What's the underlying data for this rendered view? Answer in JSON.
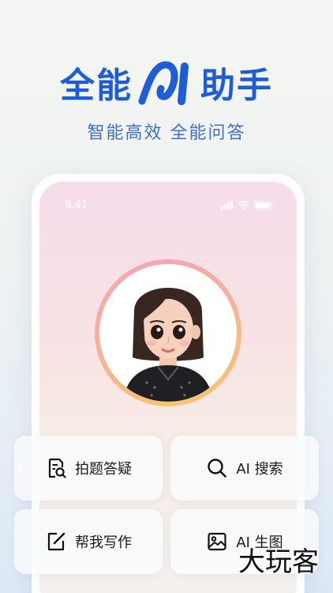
{
  "hero": {
    "title_left": "全能",
    "title_ai": "AI",
    "title_right": "助手",
    "subtitle": "智能高效 全能问答"
  },
  "phone": {
    "status_time": "9:41",
    "status_icons": [
      "signal-icon",
      "wifi-icon",
      "battery-icon"
    ]
  },
  "features": [
    {
      "label": "拍题答疑",
      "icon": "scan-question-icon"
    },
    {
      "label": "AI 搜索",
      "icon": "search-icon"
    },
    {
      "label": "帮我写作",
      "icon": "edit-icon"
    },
    {
      "label": "AI 生图",
      "icon": "image-icon"
    }
  ],
  "watermark": "大玩客",
  "colors": {
    "brand_blue": "#1e5dd6",
    "subtitle_blue": "#3d6fc6"
  }
}
